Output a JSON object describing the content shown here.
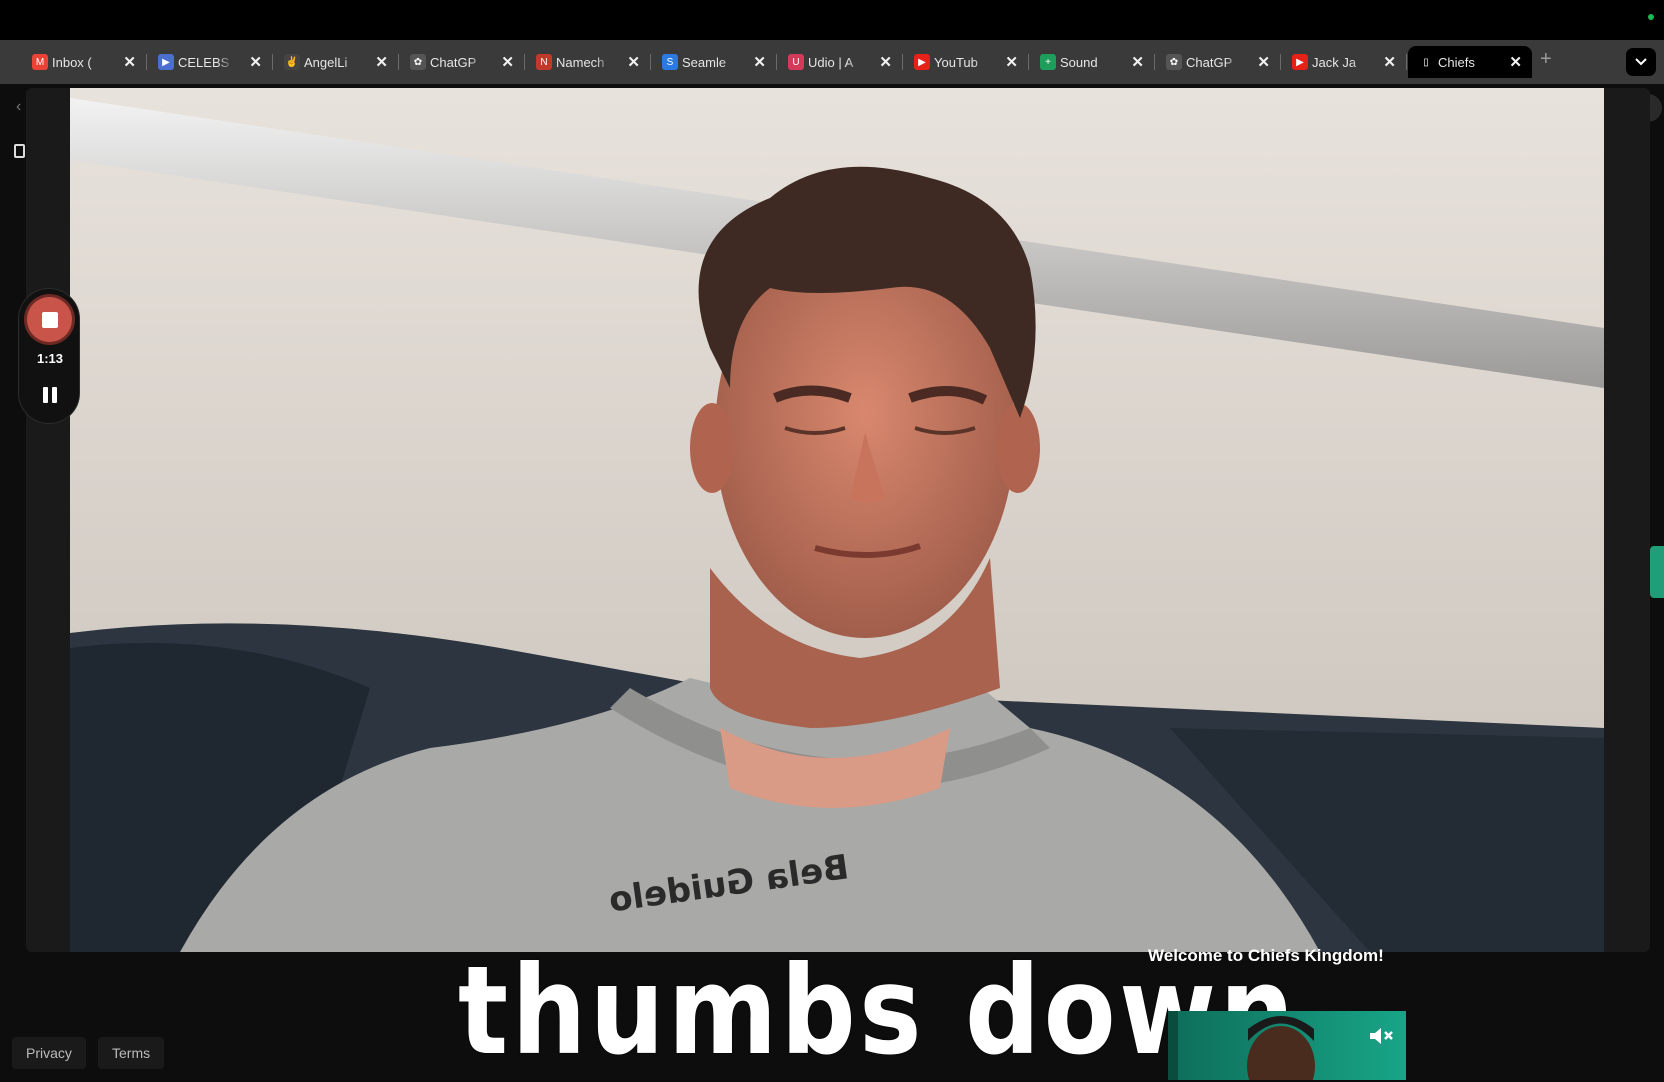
{
  "browser": {
    "tabs": [
      {
        "label": "Inbox (",
        "icon": "gmail-icon",
        "color": "#ea4335",
        "glyph": "M"
      },
      {
        "label": "CELEBS",
        "icon": "celebs-icon",
        "color": "#4a6fd0",
        "glyph": "▶"
      },
      {
        "label": "AngelLi",
        "icon": "angellist-icon",
        "color": "#444444",
        "glyph": "✌"
      },
      {
        "label": "ChatGP",
        "icon": "openai-icon",
        "color": "#555555",
        "glyph": "✿"
      },
      {
        "label": "Namech",
        "icon": "namecheap-icon",
        "color": "#c0392b",
        "glyph": "N"
      },
      {
        "label": "Seamle",
        "icon": "seamless-icon",
        "color": "#2a7ae2",
        "glyph": "S"
      },
      {
        "label": "Udio | A",
        "icon": "udio-icon",
        "color": "#d63a5a",
        "glyph": "U"
      },
      {
        "label": "YouTub",
        "icon": "youtube-icon",
        "color": "#e62117",
        "glyph": "▶"
      },
      {
        "label": "Sound",
        "icon": "sheets-icon",
        "color": "#1e9e5a",
        "glyph": "+"
      },
      {
        "label": "ChatGP",
        "icon": "openai-icon",
        "color": "#555555",
        "glyph": "✿"
      },
      {
        "label": "Jack Ja",
        "icon": "youtube-icon",
        "color": "#e62117",
        "glyph": "▶"
      },
      {
        "label": "Chiefs",
        "icon": "document-icon",
        "color": "#000000",
        "glyph": "▯",
        "active": true
      }
    ],
    "close_glyph": "✕",
    "new_tab_glyph": "+",
    "tab_menu_glyph": "⌄"
  },
  "recorder": {
    "elapsed": "1:13",
    "stop_color": "#c9554a"
  },
  "overlay": {
    "welcome_text": "Welcome to Chiefs Kingdom!",
    "caption_text": "thumbs down"
  },
  "footer": {
    "privacy_label": "Privacy",
    "terms_label": "Terms"
  },
  "colors": {
    "accent_green": "#1f9e78",
    "tabstrip": "#3a3a3a",
    "active_tab": "#000000"
  }
}
